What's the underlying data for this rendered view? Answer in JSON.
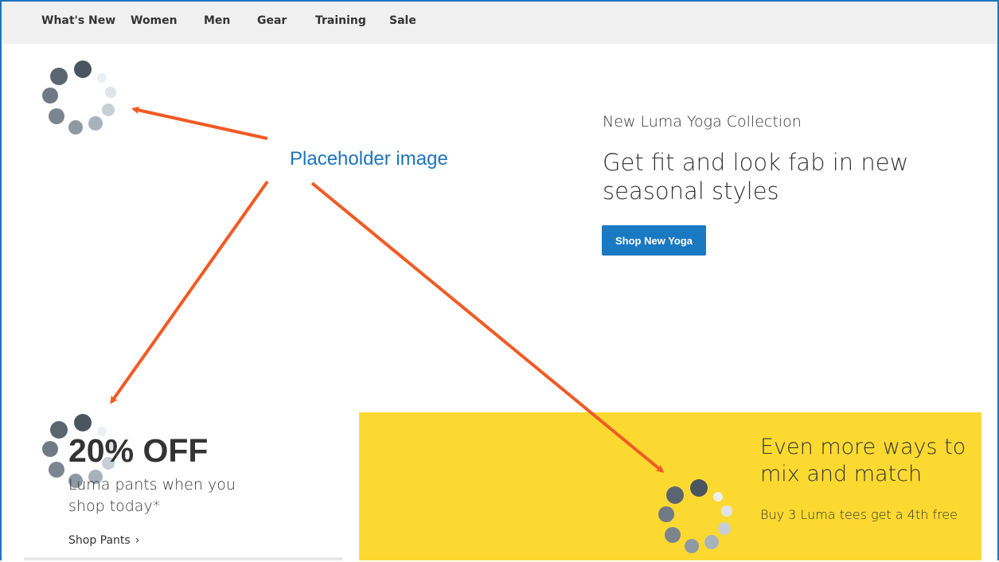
{
  "nav": {
    "items": [
      {
        "label": "What's New"
      },
      {
        "label": "Women"
      },
      {
        "label": "Men"
      },
      {
        "label": "Gear"
      },
      {
        "label": "Training"
      },
      {
        "label": "Sale"
      }
    ]
  },
  "hero": {
    "eyebrow": "New Luma Yoga Collection",
    "title": "Get fit and look fab in new seasonal styles",
    "button_label": "Shop New Yoga"
  },
  "annotation": {
    "label": "Placeholder image"
  },
  "sale_block": {
    "headline": "20% OFF",
    "text": "Luma pants when you shop today*",
    "link_label": "Shop Pants",
    "link_icon": "chevron-right-icon"
  },
  "promo_block": {
    "title": "Even more ways to mix and match",
    "text": "Buy 3 Luma tees get a 4th free"
  },
  "colors": {
    "accent": "#1979c3",
    "annotation": "#1d74bd",
    "arrow": "#f15a24",
    "promo_background": "#fcd931",
    "nav_background": "#f0f0f0"
  }
}
